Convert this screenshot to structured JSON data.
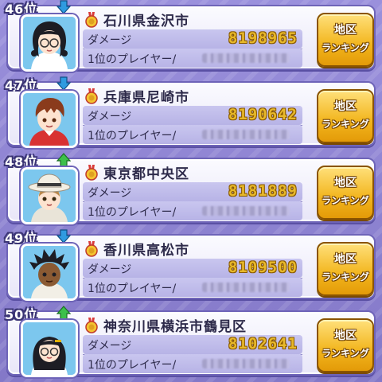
{
  "colors": {
    "accent_gold": "#e7b82a",
    "rank_up": "#3cc04a",
    "rank_down": "#2f9be0",
    "panel_border": "#6e64b8"
  },
  "rows": [
    {
      "rank": "46位",
      "trend": "down",
      "region": "石川県金沢市",
      "damage_label": "ダメージ",
      "damage": "8198965",
      "player_label": "1位のプレイヤー/",
      "button_line1": "地区",
      "button_line2": "ランキング"
    },
    {
      "rank": "47位",
      "trend": "down",
      "region": "兵庫県尼崎市",
      "damage_label": "ダメージ",
      "damage": "8190642",
      "player_label": "1位のプレイヤー/",
      "button_line1": "地区",
      "button_line2": "ランキング"
    },
    {
      "rank": "48位",
      "trend": "up",
      "region": "東京都中央区",
      "damage_label": "ダメージ",
      "damage": "8181889",
      "player_label": "1位のプレイヤー/",
      "button_line1": "地区",
      "button_line2": "ランキング"
    },
    {
      "rank": "49位",
      "trend": "down",
      "region": "香川県高松市",
      "damage_label": "ダメージ",
      "damage": "8109500",
      "player_label": "1位のプレイヤー/",
      "button_line1": "地区",
      "button_line2": "ランキング"
    },
    {
      "rank": "50位",
      "trend": "up",
      "region": "神奈川県横浜市鶴見区",
      "damage_label": "ダメージ",
      "damage": "8102641",
      "player_label": "1位のプレイヤー/",
      "button_line1": "地区",
      "button_line2": "ランキング"
    }
  ]
}
